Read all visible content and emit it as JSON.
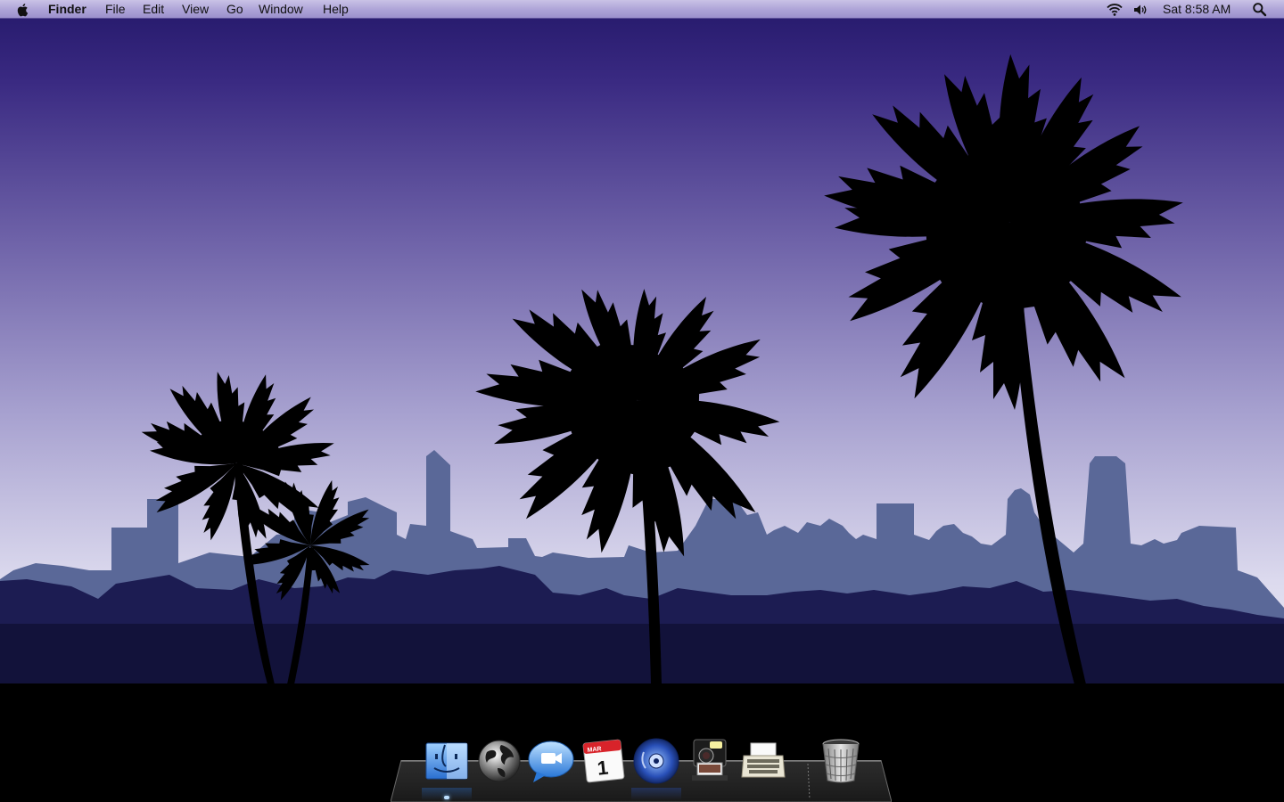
{
  "menubar": {
    "apple_icon": "apple-logo-icon",
    "app_name": "Finder",
    "menus": [
      "File",
      "Edit",
      "View",
      "Go",
      "Window",
      "Help"
    ],
    "status": {
      "wifi_icon": "wifi-icon",
      "volume_icon": "volume-icon",
      "clock": "Sat 8:58 AM",
      "spotlight_icon": "spotlight-search-icon"
    }
  },
  "desktop": {
    "wallpaper": "palm-trees-city-skyline-dusk",
    "sky_top_color": "#2a1a6e",
    "sky_mid_color": "#8d86c0",
    "sky_horizon_color": "#e4e2f2",
    "skyline_far_color": "#5a6a9b",
    "skyline_near_color": "#1a1a4e"
  },
  "dock": {
    "items": [
      {
        "name": "Finder",
        "icon": "finder-icon",
        "running": true
      },
      {
        "name": "Safari",
        "icon": "globe-icon",
        "running": false
      },
      {
        "name": "iChat",
        "icon": "ichat-bubble-icon",
        "running": false
      },
      {
        "name": "iCal",
        "icon": "calendar-icon",
        "month": "MAR",
        "day": "1",
        "running": false
      },
      {
        "name": "iTunes",
        "icon": "itunes-cd-icon",
        "running": false
      },
      {
        "name": "Photo Booth",
        "icon": "camera-icon",
        "running": false
      },
      {
        "name": "TextEdit",
        "icon": "typewriter-icon",
        "running": false
      },
      {
        "name": "Trash",
        "icon": "trash-icon",
        "running": false
      }
    ]
  }
}
